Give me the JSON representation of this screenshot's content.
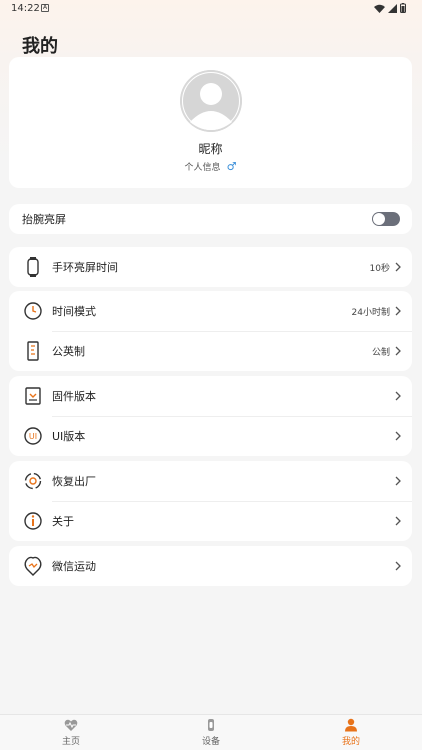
{
  "status_bar": {
    "time": "14:22",
    "notif_glyph": "A"
  },
  "page_title": "我的",
  "profile": {
    "nickname": "昵称",
    "info_label": "个人信息",
    "gender_symbol": "♂"
  },
  "wrist_raise": {
    "label": "抬腕亮屏",
    "enabled": false
  },
  "groups": {
    "screen_time": {
      "label": "手环亮屏时间",
      "value": "10秒"
    },
    "time_mode": {
      "label": "时间模式",
      "value": "24小时制"
    },
    "units": {
      "label": "公英制",
      "value": "公制"
    },
    "firmware": {
      "label": "固件版本",
      "value": ""
    },
    "ui_version": {
      "label": "UI版本",
      "value": "",
      "icon_text": "UI"
    },
    "factory_reset": {
      "label": "恢复出厂",
      "value": ""
    },
    "about": {
      "label": "关于",
      "value": ""
    },
    "wechat_sport": {
      "label": "微信运动",
      "value": ""
    }
  },
  "bottom_nav": {
    "home": "主页",
    "device": "设备",
    "mine": "我的"
  },
  "colors": {
    "accent": "#e8731a",
    "toggle_off": "#6b6f7a",
    "gender": "#3a8fd9"
  },
  "icons": [
    "watch-icon",
    "clock-icon",
    "ruler-icon",
    "firmware-icon",
    "ui-icon",
    "reset-icon",
    "info-icon",
    "wechat-sport-icon",
    "heart-pulse-icon",
    "device-icon",
    "person-icon"
  ]
}
